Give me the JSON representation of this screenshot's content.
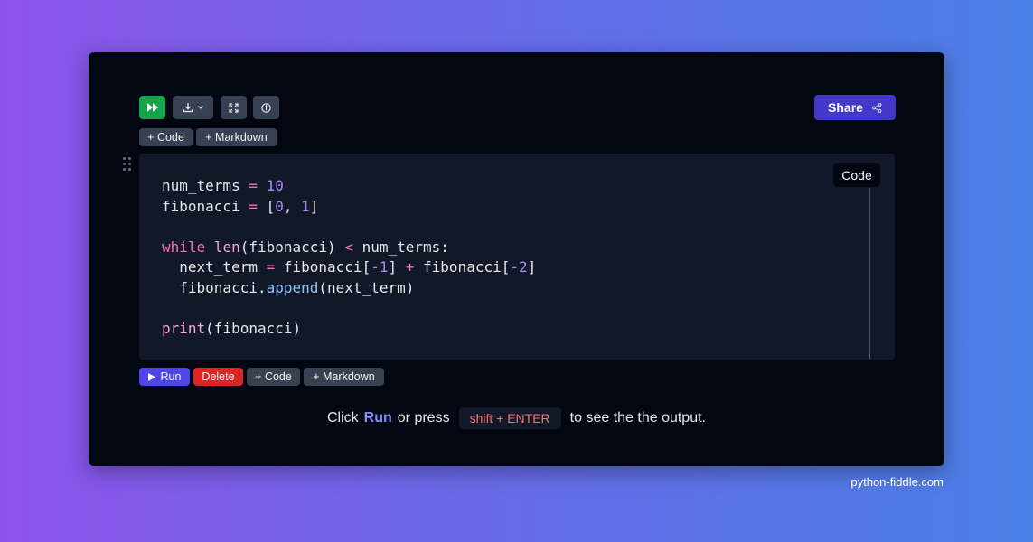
{
  "toolbar": {
    "run_all_icon": "fast-forward-icon",
    "download_icon": "download-icon",
    "fullscreen_icon": "expand-icon",
    "info_icon": "info-icon",
    "share_label": "Share",
    "share_icon": "share-icon"
  },
  "top_add": {
    "code_label": "+ Code",
    "markdown_label": "+ Markdown"
  },
  "cell": {
    "tooltip": "Code",
    "code_lines": [
      "num_terms = 10",
      "fibonacci = [0, 1]",
      "",
      "while len(fibonacci) < num_terms:",
      "  next_term = fibonacci[-1] + fibonacci[-2]",
      "  fibonacci.append(next_term)",
      "",
      "print(fibonacci)"
    ]
  },
  "cell_actions": {
    "run_label": "Run",
    "delete_label": "Delete",
    "code_label": "+ Code",
    "markdown_label": "+ Markdown"
  },
  "hint": {
    "click": "Click",
    "run": "Run",
    "or_press": "or press",
    "shortcut": "shift + ENTER",
    "rest": "to see the the output."
  },
  "credit": "python-fiddle.com",
  "colors": {
    "run_green": "#16a34a",
    "share_indigo": "#4338ca",
    "run_indigo": "#4f46e5",
    "delete_red": "#dc2626"
  }
}
